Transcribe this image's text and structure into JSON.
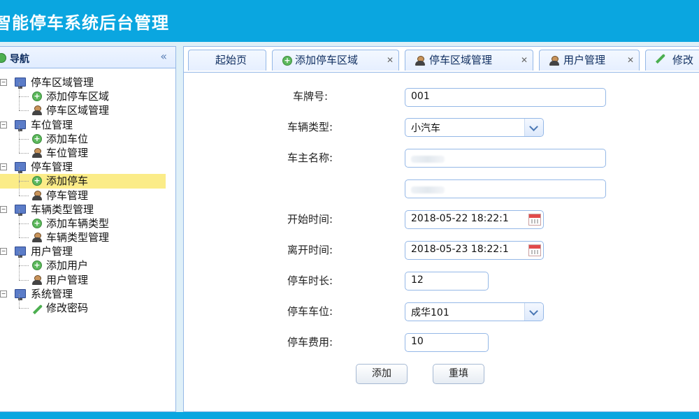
{
  "app": {
    "title": "智能停车系统后台管理"
  },
  "sidebar": {
    "title": "导航",
    "collapse_glyph": "«",
    "groups": [
      {
        "label": "停车区域管理",
        "children": [
          {
            "label": "添加停车区域",
            "icon": "add-icon"
          },
          {
            "label": "停车区域管理",
            "icon": "user-icon"
          }
        ]
      },
      {
        "label": "车位管理",
        "children": [
          {
            "label": "添加车位",
            "icon": "add-icon"
          },
          {
            "label": "车位管理",
            "icon": "user-icon"
          }
        ]
      },
      {
        "label": "停车管理",
        "children": [
          {
            "label": "添加停车",
            "icon": "add-icon",
            "selected": true
          },
          {
            "label": "停车管理",
            "icon": "user-icon"
          }
        ]
      },
      {
        "label": "车辆类型管理",
        "children": [
          {
            "label": "添加车辆类型",
            "icon": "add-icon"
          },
          {
            "label": "车辆类型管理",
            "icon": "user-icon"
          }
        ]
      },
      {
        "label": "用户管理",
        "children": [
          {
            "label": "添加用户",
            "icon": "add-icon"
          },
          {
            "label": "用户管理",
            "icon": "user-icon"
          }
        ]
      },
      {
        "label": "系统管理",
        "children": [
          {
            "label": "修改密码",
            "icon": "pencil-icon"
          }
        ]
      }
    ]
  },
  "tabs": [
    {
      "label": "起始页",
      "icon": "",
      "closable": false
    },
    {
      "label": "添加停车区域",
      "icon": "add-icon",
      "closable": true
    },
    {
      "label": "停车区域管理",
      "icon": "user-icon",
      "closable": true
    },
    {
      "label": "用户管理",
      "icon": "user-icon",
      "closable": true
    },
    {
      "label": "修改",
      "icon": "pencil-icon",
      "closable": false
    }
  ],
  "form": {
    "plate": {
      "label": "车牌号:",
      "value": "001"
    },
    "vehicle_type": {
      "label": "车辆类型:",
      "value": "小汽车"
    },
    "owner": {
      "label": "车主名称:",
      "value": ""
    },
    "extra": {
      "value": ""
    },
    "start_time": {
      "label": "开始时间:",
      "value": "2018-05-22 18:22:1"
    },
    "end_time": {
      "label": "离开时间:",
      "value": "2018-05-23 18:22:1"
    },
    "duration": {
      "label": "停车时长:",
      "value": "12"
    },
    "space": {
      "label": "停车车位:",
      "value": "成华101"
    },
    "fee": {
      "label": "停车费用:",
      "value": "10"
    },
    "submit_label": "添加",
    "reset_label": "重填"
  },
  "colors": {
    "brand": "#0aa6e0",
    "selected_row": "#fbec88",
    "border": "#95b8e7"
  }
}
